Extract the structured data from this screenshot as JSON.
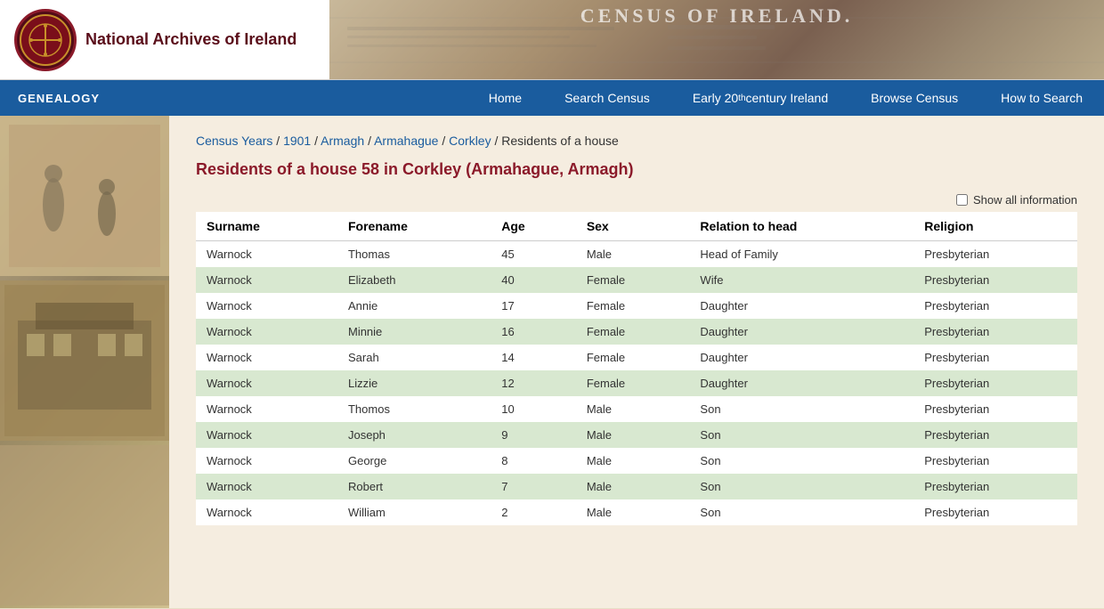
{
  "header": {
    "logo_text": "National Archives of Ireland",
    "banner_text": "CENSUS OF IRELAND."
  },
  "navbar": {
    "brand": "GENEALOGY",
    "links": [
      {
        "id": "home",
        "label": "Home"
      },
      {
        "id": "search-census",
        "label": "Search Census"
      },
      {
        "id": "early-20th",
        "label": "Early 20",
        "sup": "th",
        "suffix": " century Ireland"
      },
      {
        "id": "browse-census",
        "label": "Browse Census"
      },
      {
        "id": "how-to-search",
        "label": "How to Search"
      }
    ]
  },
  "breadcrumb": {
    "items": [
      {
        "id": "census-years",
        "label": "Census Years",
        "link": true
      },
      {
        "id": "1901",
        "label": "1901",
        "link": true
      },
      {
        "id": "armagh",
        "label": "Armagh",
        "link": true
      },
      {
        "id": "armahague",
        "label": "Armahague",
        "link": true
      },
      {
        "id": "corkley",
        "label": "Corkley",
        "link": true
      }
    ],
    "current": "Residents of a house"
  },
  "page_title": "Residents of a house 58 in Corkley (Armahague, Armagh)",
  "show_all_label": "Show all information",
  "table": {
    "headers": [
      "Surname",
      "Forename",
      "Age",
      "Sex",
      "Relation to head",
      "Religion"
    ],
    "rows": [
      {
        "surname": "Warnock",
        "forename": "Thomas",
        "age": "45",
        "sex": "Male",
        "relation": "Head of Family",
        "religion": "Presbyterian"
      },
      {
        "surname": "Warnock",
        "forename": "Elizabeth",
        "age": "40",
        "sex": "Female",
        "relation": "Wife",
        "religion": "Presbyterian"
      },
      {
        "surname": "Warnock",
        "forename": "Annie",
        "age": "17",
        "sex": "Female",
        "relation": "Daughter",
        "religion": "Presbyterian"
      },
      {
        "surname": "Warnock",
        "forename": "Minnie",
        "age": "16",
        "sex": "Female",
        "relation": "Daughter",
        "religion": "Presbyterian"
      },
      {
        "surname": "Warnock",
        "forename": "Sarah",
        "age": "14",
        "sex": "Female",
        "relation": "Daughter",
        "religion": "Presbyterian"
      },
      {
        "surname": "Warnock",
        "forename": "Lizzie",
        "age": "12",
        "sex": "Female",
        "relation": "Daughter",
        "religion": "Presbyterian"
      },
      {
        "surname": "Warnock",
        "forename": "Thomos",
        "age": "10",
        "sex": "Male",
        "relation": "Son",
        "religion": "Presbyterian"
      },
      {
        "surname": "Warnock",
        "forename": "Joseph",
        "age": "9",
        "sex": "Male",
        "relation": "Son",
        "religion": "Presbyterian"
      },
      {
        "surname": "Warnock",
        "forename": "George",
        "age": "8",
        "sex": "Male",
        "relation": "Son",
        "religion": "Presbyterian"
      },
      {
        "surname": "Warnock",
        "forename": "Robert",
        "age": "7",
        "sex": "Male",
        "relation": "Son",
        "religion": "Presbyterian"
      },
      {
        "surname": "Warnock",
        "forename": "William",
        "age": "2",
        "sex": "Male",
        "relation": "Son",
        "religion": "Presbyterian"
      }
    ]
  }
}
